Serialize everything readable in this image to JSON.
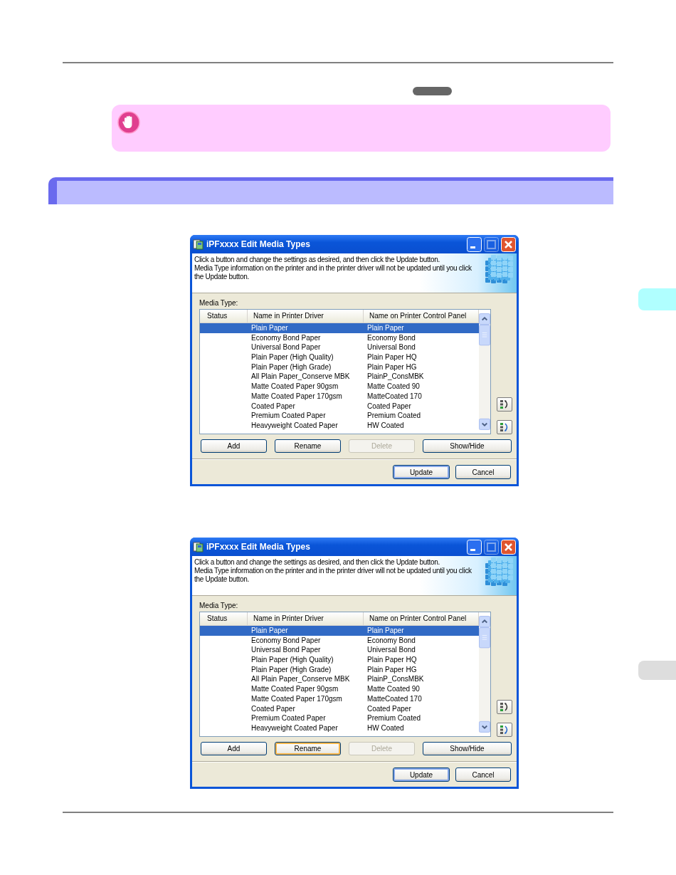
{
  "side_tabs": [
    {
      "selected": true
    },
    {
      "selected": false
    }
  ],
  "dialogs": [
    {
      "title": "iPFxxxx Edit Media Types",
      "window_buttons": [
        {
          "kind": "minimize",
          "disabled": false
        },
        {
          "kind": "maximize",
          "disabled": true
        },
        {
          "kind": "close",
          "disabled": false
        }
      ],
      "instructions": "Click a button and change the settings as desired, and then click the Update button.\nMedia Type information on the printer and in the printer driver will not be updated until you click\nthe Update button.",
      "list_label": "Media Type:",
      "columns": [
        "Status",
        "Name in Printer Driver",
        "Name on Printer Control Panel"
      ],
      "rows": [
        {
          "driver_name": "Plain Paper",
          "panel_name": "Plain Paper",
          "selected": true
        },
        {
          "driver_name": "Economy Bond Paper",
          "panel_name": "Economy Bond",
          "selected": false
        },
        {
          "driver_name": "Universal Bond Paper",
          "panel_name": "Universal Bond",
          "selected": false
        },
        {
          "driver_name": "Plain Paper (High Quality)",
          "panel_name": "Plain Paper HQ",
          "selected": false
        },
        {
          "driver_name": "Plain Paper (High Grade)",
          "panel_name": "Plain Paper HG",
          "selected": false
        },
        {
          "driver_name": "All Plain Paper_Conserve MBK",
          "panel_name": "PlainP_ConsMBK",
          "selected": false
        },
        {
          "driver_name": "Matte Coated Paper 90gsm",
          "panel_name": "Matte Coated 90",
          "selected": false
        },
        {
          "driver_name": "Matte Coated Paper 170gsm",
          "panel_name": "MatteCoated 170",
          "selected": false
        },
        {
          "driver_name": "Coated Paper",
          "panel_name": "Coated Paper",
          "selected": false
        },
        {
          "driver_name": "Premium Coated Paper",
          "panel_name": "Premium Coated",
          "selected": false
        },
        {
          "driver_name": "Heavyweight Coated Paper",
          "panel_name": "HW Coated",
          "selected": false
        }
      ],
      "buttons": [
        {
          "label": "Add",
          "disabled": false,
          "focused": false
        },
        {
          "label": "Rename",
          "disabled": false,
          "focused": false
        },
        {
          "label": "Delete",
          "disabled": true,
          "focused": false
        },
        {
          "label": "Show/Hide",
          "disabled": false,
          "focused": false
        }
      ],
      "footer_buttons": [
        {
          "label": "Update",
          "default": true
        },
        {
          "label": "Cancel",
          "default": false
        }
      ]
    },
    {
      "title": "iPFxxxx Edit Media Types",
      "window_buttons": [
        {
          "kind": "minimize",
          "disabled": false
        },
        {
          "kind": "maximize",
          "disabled": true
        },
        {
          "kind": "close",
          "disabled": false
        }
      ],
      "instructions": "Click a button and change the settings as desired, and then click the Update button.\nMedia Type information on the printer and in the printer driver will not be updated until you click\nthe Update button.",
      "list_label": "Media Type:",
      "columns": [
        "Status",
        "Name in Printer Driver",
        "Name on Printer Control Panel"
      ],
      "rows": [
        {
          "driver_name": "Plain Paper",
          "panel_name": "Plain Paper",
          "selected": true
        },
        {
          "driver_name": "Economy Bond Paper",
          "panel_name": "Economy Bond",
          "selected": false
        },
        {
          "driver_name": "Universal Bond Paper",
          "panel_name": "Universal Bond",
          "selected": false
        },
        {
          "driver_name": "Plain Paper (High Quality)",
          "panel_name": "Plain Paper HQ",
          "selected": false
        },
        {
          "driver_name": "Plain Paper (High Grade)",
          "panel_name": "Plain Paper HG",
          "selected": false
        },
        {
          "driver_name": "All Plain Paper_Conserve MBK",
          "panel_name": "PlainP_ConsMBK",
          "selected": false
        },
        {
          "driver_name": "Matte Coated Paper 90gsm",
          "panel_name": "Matte Coated 90",
          "selected": false
        },
        {
          "driver_name": "Matte Coated Paper 170gsm",
          "panel_name": "MatteCoated 170",
          "selected": false
        },
        {
          "driver_name": "Coated Paper",
          "panel_name": "Coated Paper",
          "selected": false
        },
        {
          "driver_name": "Premium Coated Paper",
          "panel_name": "Premium Coated",
          "selected": false
        },
        {
          "driver_name": "Heavyweight Coated Paper",
          "panel_name": "HW Coated",
          "selected": false
        }
      ],
      "buttons": [
        {
          "label": "Add",
          "disabled": false,
          "focused": false
        },
        {
          "label": "Rename",
          "disabled": false,
          "focused": true
        },
        {
          "label": "Delete",
          "disabled": true,
          "focused": false
        },
        {
          "label": "Show/Hide",
          "disabled": false,
          "focused": false
        }
      ],
      "footer_buttons": [
        {
          "label": "Update",
          "default": true
        },
        {
          "label": "Cancel",
          "default": false
        }
      ]
    }
  ]
}
